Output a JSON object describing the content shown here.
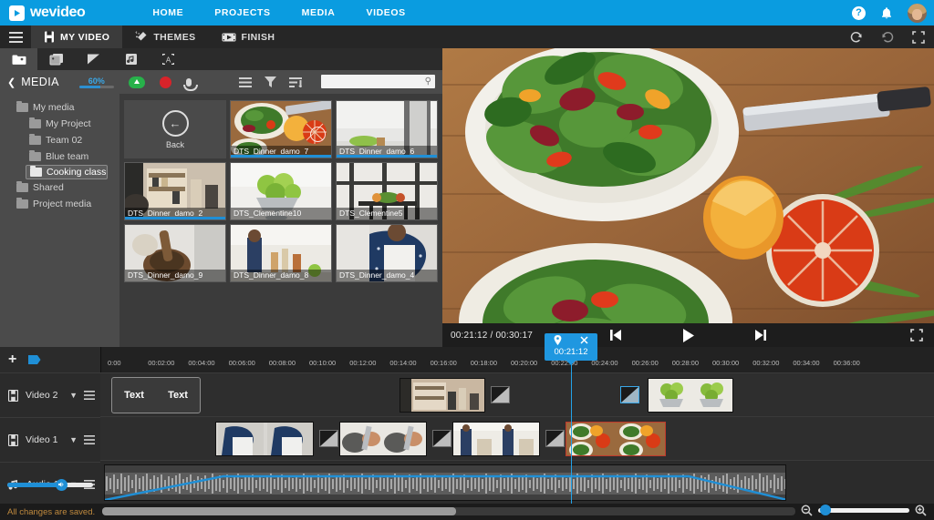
{
  "app": {
    "brand": "wevideo",
    "top_nav": [
      "HOME",
      "PROJECTS",
      "MEDIA",
      "VIDEOS"
    ],
    "help_label": "?",
    "icons": {
      "help": "help-icon",
      "notifications": "bell-icon",
      "avatar": "user-avatar"
    }
  },
  "tabbar": {
    "menu_icon": "hamburger-icon",
    "tabs": [
      {
        "label": "MY VIDEO",
        "icon": "film-icon",
        "active": true
      },
      {
        "label": "THEMES",
        "icon": "sparkle-icon",
        "active": false
      },
      {
        "label": "FINISH",
        "icon": "export-icon",
        "active": false
      }
    ],
    "redo_icon": "redo-icon",
    "undo_icon": "undo-icon",
    "fullscreen_icon": "fullscreen-icon"
  },
  "media_panel": {
    "icon_tabs": [
      "media-tab",
      "transitions-tab",
      "graphics-tab",
      "audio-tab",
      "text-tab"
    ],
    "back_chevron": "chevron-left-icon",
    "title": "MEDIA",
    "storage_percent": "60%",
    "upload_icon": "cloud-upload-icon",
    "record_icon": "record-icon",
    "mic_icon": "microphone-icon",
    "view_list_icon": "list-view-icon",
    "filter_icon": "filter-icon",
    "sort_icon": "sort-icon",
    "search_placeholder": "",
    "search_value": "",
    "tree": [
      {
        "label": "My media",
        "level": 1,
        "selected": false,
        "open": false
      },
      {
        "label": "My Project",
        "level": 2,
        "selected": false,
        "open": false
      },
      {
        "label": "Team 02",
        "level": 2,
        "selected": false,
        "open": false
      },
      {
        "label": "Blue team",
        "level": 2,
        "selected": false,
        "open": false
      },
      {
        "label": "Cooking class",
        "level": 2,
        "selected": true,
        "open": true
      },
      {
        "label": "Shared",
        "level": 1,
        "selected": false,
        "open": false
      },
      {
        "label": "Project media",
        "level": 1,
        "selected": false,
        "open": false
      }
    ],
    "back_tile_label": "Back",
    "items": [
      {
        "name": "DTS_Dinner_damo_7",
        "used": true,
        "badge": true
      },
      {
        "name": "DTS_Dinner_damo_6",
        "used": true,
        "badge": false
      },
      {
        "name": "DTS_Dinner_damo_2",
        "used": true,
        "badge": false
      },
      {
        "name": "DTS_Clementine10",
        "used": false,
        "badge": false
      },
      {
        "name": "DTS_Clementine5",
        "used": false,
        "badge": false
      },
      {
        "name": "DTS_Dinner_damo_9",
        "used": false,
        "badge": false
      },
      {
        "name": "DTS_Dinner_damo_8",
        "used": false,
        "badge": false
      },
      {
        "name": "DTS_Dinner_damo_4",
        "used": false,
        "badge": false
      }
    ]
  },
  "preview": {
    "current_time": "00:21:12",
    "total_time": "00:30:17",
    "time_display": "00:21:12 / 00:30:17",
    "prev_icon": "skip-previous-icon",
    "play_icon": "play-icon",
    "next_icon": "skip-next-icon",
    "fullscreen_icon": "fullscreen-icon"
  },
  "timeline": {
    "add_track_icon": "add-track-icon",
    "marker_icon": "marker-icon",
    "ruler_ticks": [
      "0:00",
      "00:02:00",
      "00:04:00",
      "00:06:00",
      "00:08:00",
      "00:10:00",
      "00:12:00",
      "00:14:00",
      "00:16:00",
      "00:18:00",
      "00:20:00",
      "00:22:00",
      "00:24:00",
      "00:26:00",
      "00:28:00",
      "00:30:00",
      "00:32:00",
      "00:34:00",
      "00:36:00"
    ],
    "playhead_time": "00:21:12",
    "playhead_pin_icon": "pin-icon",
    "playhead_close_icon": "close-icon",
    "tracks": [
      {
        "name": "Video 2",
        "icon": "film-icon",
        "type": "video"
      },
      {
        "name": "Video 1",
        "icon": "film-icon",
        "type": "video"
      },
      {
        "name": "Audio 1",
        "icon": "music-note-icon",
        "type": "audio"
      }
    ],
    "track_menu_icon": "track-menu-icon",
    "track_caret_icon": "chevron-down-icon",
    "volume_value": 62,
    "text_clip_labels": [
      "Text",
      "Text"
    ],
    "zoom_out_icon": "zoom-out-icon",
    "zoom_in_icon": "zoom-in-icon",
    "zoom_value": 2
  },
  "status": {
    "message": "All changes are saved."
  },
  "colors": {
    "brand_blue": "#0a9ce0",
    "playhead": "#23a3e8",
    "accent": "#1f8fd6",
    "status_text": "#c08a3e",
    "record": "#d8232a",
    "upload": "#27b14a"
  }
}
